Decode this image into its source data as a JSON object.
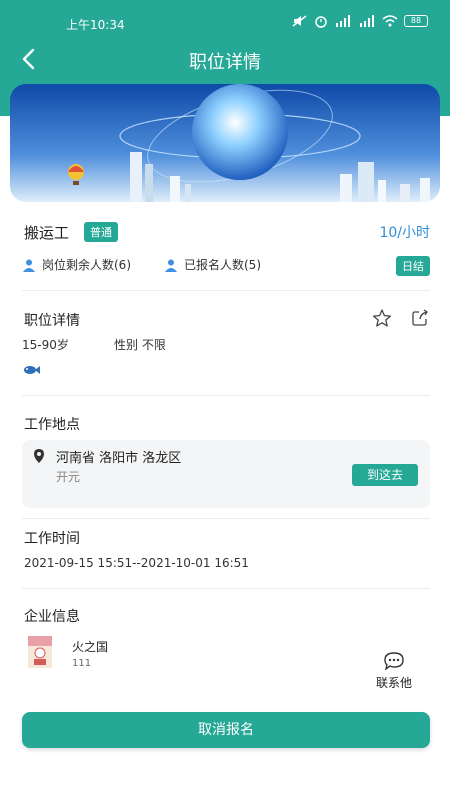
{
  "status_bar": {
    "time": "上午10:34",
    "battery": "88"
  },
  "nav": {
    "title": "职位详情"
  },
  "job": {
    "name": "搬运工",
    "tag": "普通",
    "salary": "10/小时",
    "remaining_label": "岗位剩余人数(6)",
    "signed_label": "已报名人数(5)",
    "pay_type": "日结"
  },
  "detail": {
    "title": "职位详情",
    "age": "15-90岁",
    "gender": "性别 不限"
  },
  "location": {
    "title": "工作地点",
    "address": "河南省 洛阳市 洛龙区",
    "sub": "开元",
    "goto_label": "到这去"
  },
  "work_time": {
    "title": "工作时间",
    "range": "2021-09-15 15:51--2021-10-01 16:51"
  },
  "company": {
    "title": "企业信息",
    "name": "火之国",
    "sub": "111",
    "contact_label": "联系他"
  },
  "action": {
    "cancel_label": "取消报名"
  },
  "colors": {
    "accent": "#26a896",
    "salary": "#2f8fd8"
  }
}
